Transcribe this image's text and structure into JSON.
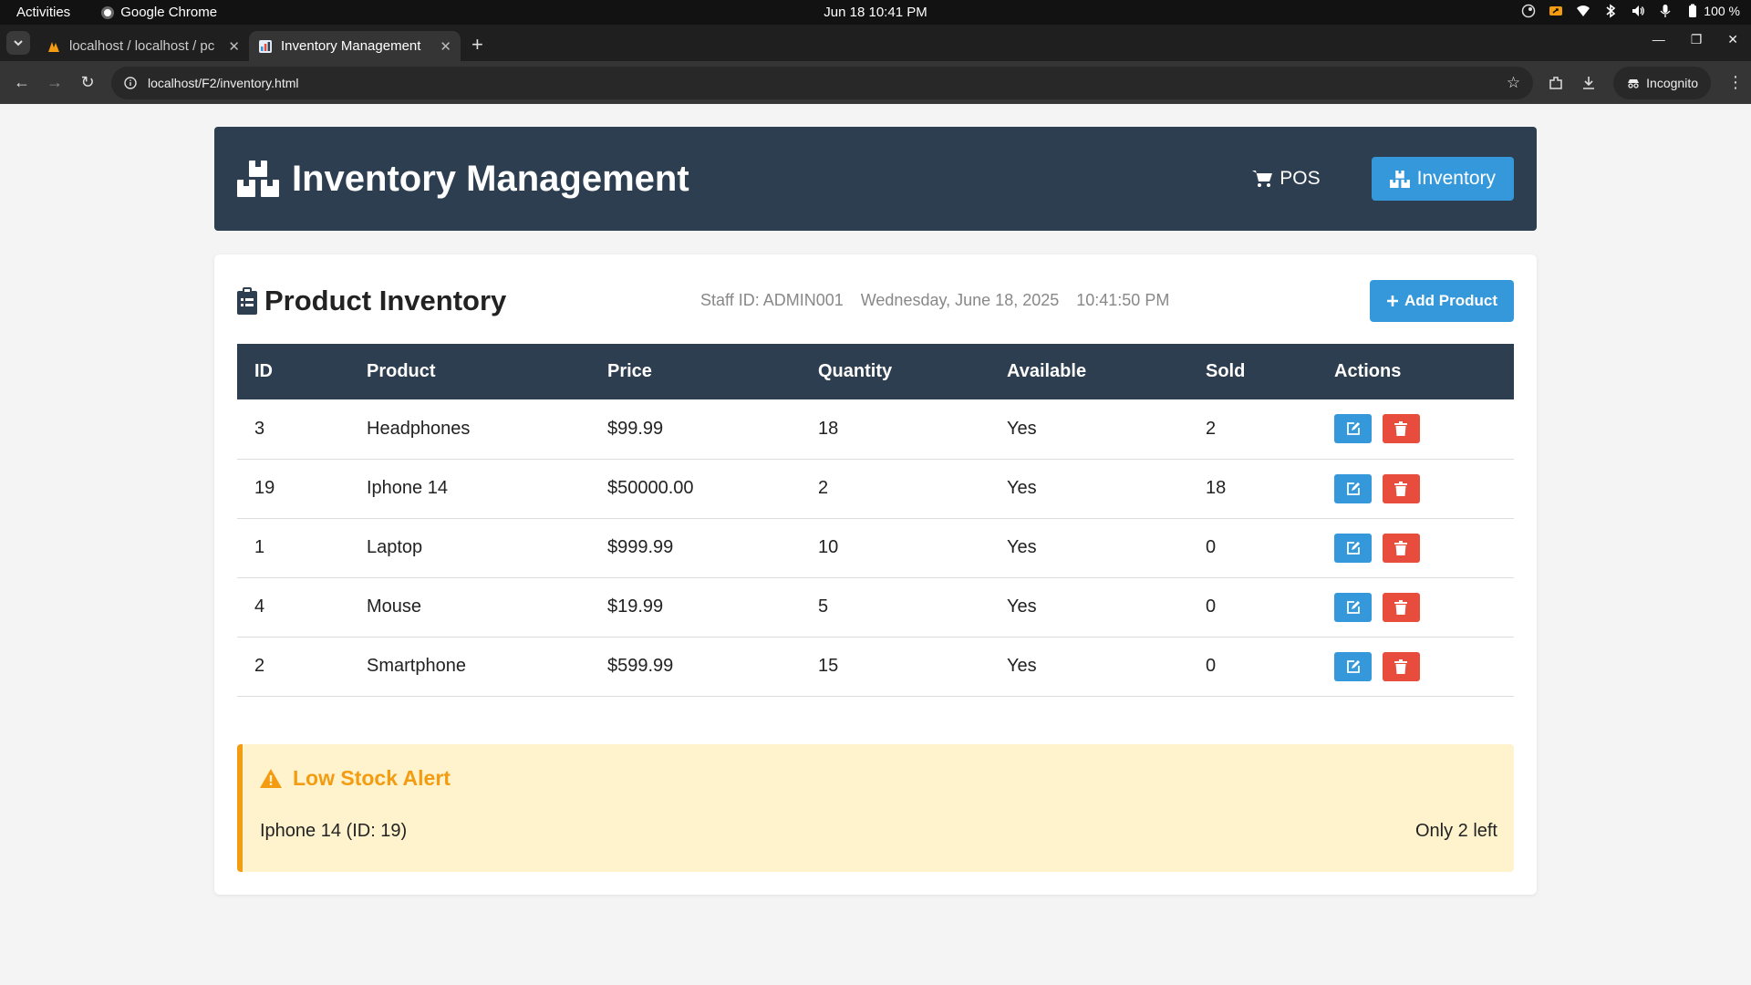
{
  "system": {
    "activities": "Activities",
    "app_name": "Google Chrome",
    "clock": "Jun 18  10:41 PM",
    "battery": "100 %"
  },
  "browser": {
    "tabs": [
      {
        "title": "localhost / localhost / pc",
        "active": false
      },
      {
        "title": "Inventory Management",
        "active": true
      }
    ],
    "url": "localhost/F2/inventory.html",
    "incognito_label": "Incognito"
  },
  "header": {
    "title": "Inventory Management",
    "nav": [
      {
        "label": "POS",
        "icon": "cart-icon"
      },
      {
        "label": "Inventory",
        "icon": "boxes-icon",
        "active": true
      }
    ]
  },
  "inventory": {
    "title": "Product Inventory",
    "staff": "Staff ID: ADMIN001",
    "date": "Wednesday, June 18, 2025",
    "time": "10:41:50 PM",
    "add_button": "Add Product",
    "columns": [
      "ID",
      "Product",
      "Price",
      "Quantity",
      "Available",
      "Sold",
      "Actions"
    ],
    "rows": [
      {
        "id": "3",
        "product": "Headphones",
        "price": "$99.99",
        "quantity": "18",
        "available": "Yes",
        "sold": "2"
      },
      {
        "id": "19",
        "product": "Iphone 14",
        "price": "$50000.00",
        "quantity": "2",
        "available": "Yes",
        "sold": "18"
      },
      {
        "id": "1",
        "product": "Laptop",
        "price": "$999.99",
        "quantity": "10",
        "available": "Yes",
        "sold": "0"
      },
      {
        "id": "4",
        "product": "Mouse",
        "price": "$19.99",
        "quantity": "5",
        "available": "Yes",
        "sold": "0"
      },
      {
        "id": "2",
        "product": "Smartphone",
        "price": "$599.99",
        "quantity": "15",
        "available": "Yes",
        "sold": "0"
      }
    ]
  },
  "alert": {
    "title": "Low Stock Alert",
    "item": "Iphone 14 (ID: 19)",
    "qty": "Only 2 left"
  },
  "colors": {
    "header_bg": "#2c3e50",
    "primary": "#3498db",
    "danger": "#e74c3c",
    "warning": "#f39c12",
    "warning_bg": "#fff3cd"
  }
}
